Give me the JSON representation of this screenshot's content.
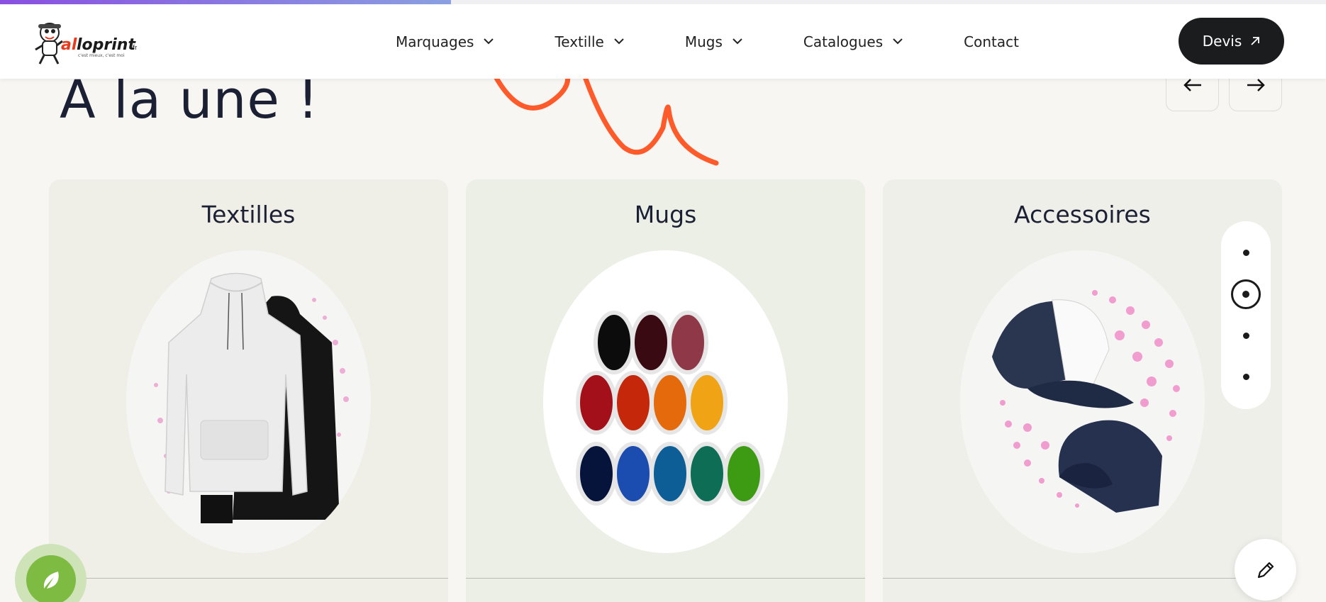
{
  "progress": {
    "percent": 34
  },
  "header": {
    "logo_text": "alloprint",
    "logo_suffix": ".fr",
    "nav": [
      {
        "label": "Marquages",
        "has_dropdown": true
      },
      {
        "label": "Textille",
        "has_dropdown": true
      },
      {
        "label": "Mugs",
        "has_dropdown": true
      },
      {
        "label": "Catalogues",
        "has_dropdown": true
      },
      {
        "label": "Contact",
        "has_dropdown": false
      }
    ],
    "cta_label": "Devis"
  },
  "section": {
    "title": "A la une !",
    "accent_color": "#ff5a2a"
  },
  "cards": [
    {
      "title": "Textilles",
      "image": "hoodie"
    },
    {
      "title": "Mugs",
      "image": "colored-mugs"
    },
    {
      "title": "Accessoires",
      "image": "trucker-caps"
    }
  ],
  "pagination": {
    "count": 4,
    "active_index": 1
  },
  "icons": {
    "prev": "arrow-left-icon",
    "next": "arrow-right-icon",
    "edit": "pencil-icon",
    "chat": "leaf-icon"
  }
}
